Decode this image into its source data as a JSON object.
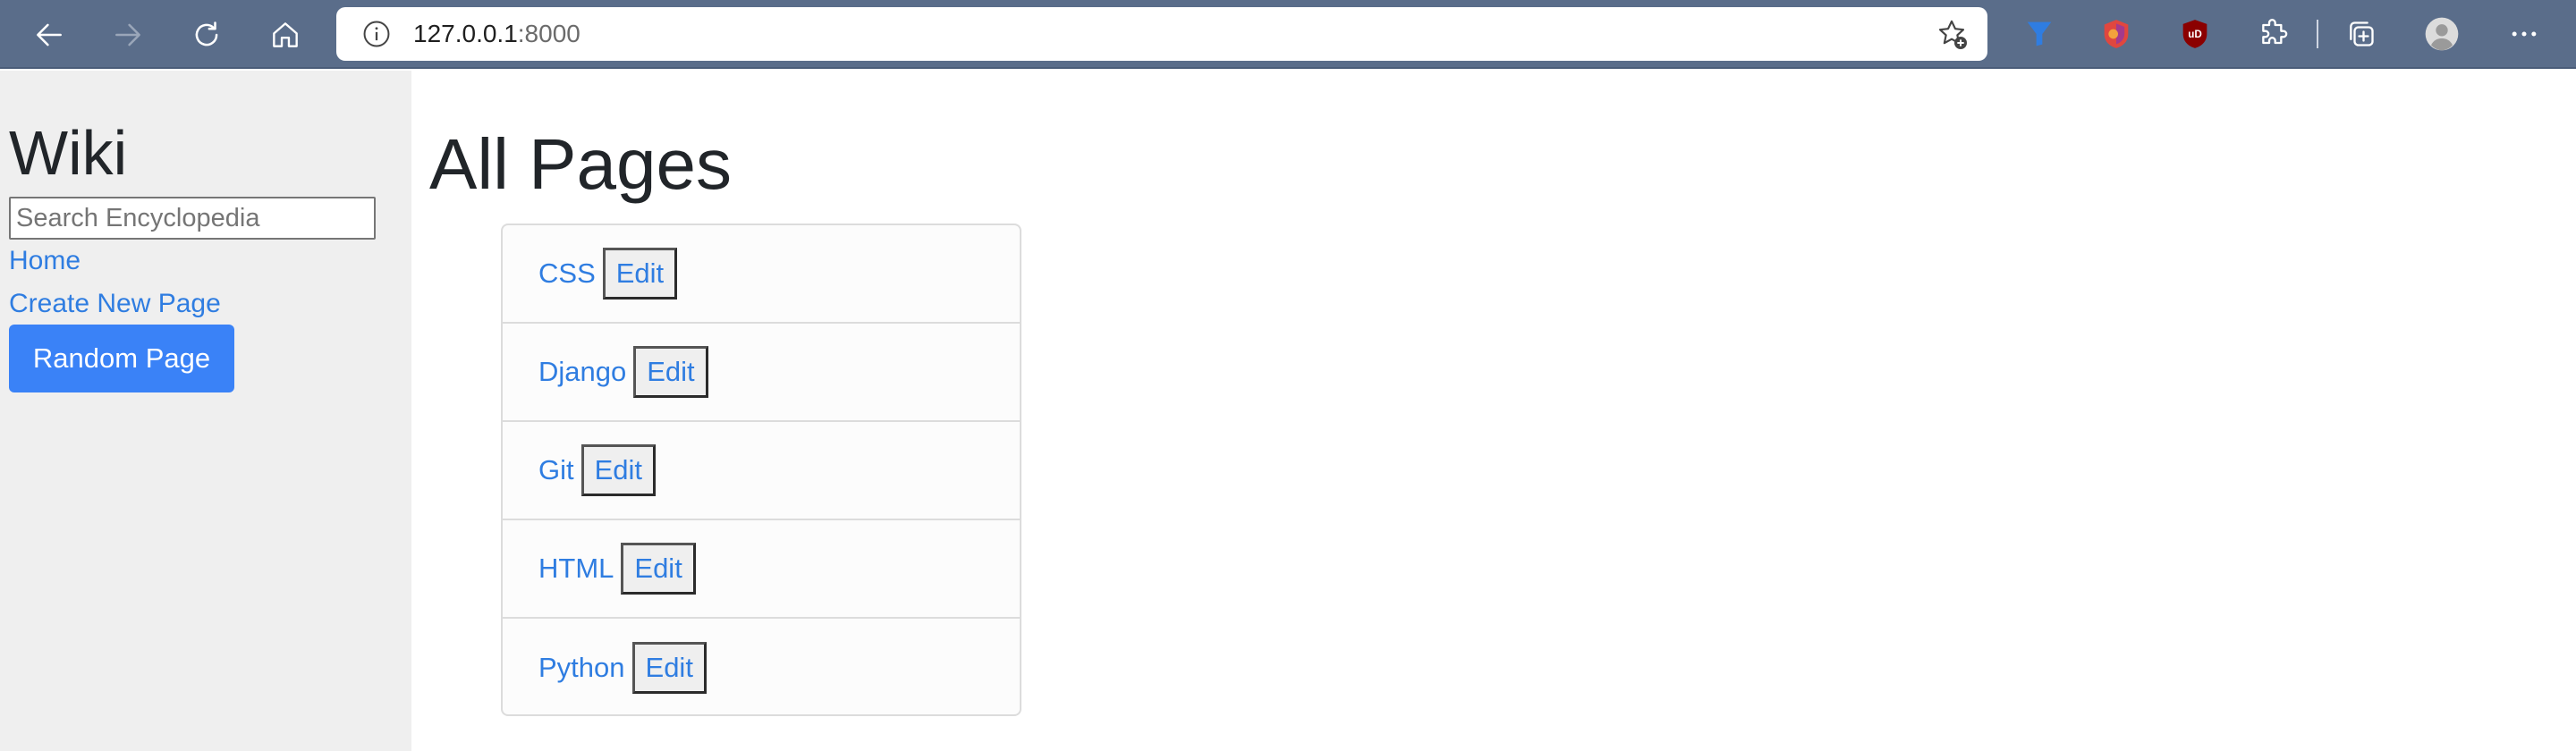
{
  "browser": {
    "url_host": "127.0.0.1",
    "url_port": ":8000",
    "toolbar_color": "#5a6d8a",
    "extensions": [
      "blue-funnel-icon",
      "firefox-relay-icon",
      "ublock-origin-icon",
      "extensions-puzzle-icon"
    ],
    "ublock_label": "uD"
  },
  "sidebar": {
    "title": "Wiki",
    "search_placeholder": "Search Encyclopedia",
    "links": {
      "home": "Home",
      "create": "Create New Page"
    },
    "random_button": "Random Page",
    "accent_color": "#3a82f7"
  },
  "main": {
    "heading": "All Pages",
    "entries": [
      {
        "title": "CSS",
        "edit_label": "Edit"
      },
      {
        "title": "Django",
        "edit_label": "Edit"
      },
      {
        "title": "Git",
        "edit_label": "Edit"
      },
      {
        "title": "HTML",
        "edit_label": "Edit"
      },
      {
        "title": "Python",
        "edit_label": "Edit"
      }
    ]
  }
}
